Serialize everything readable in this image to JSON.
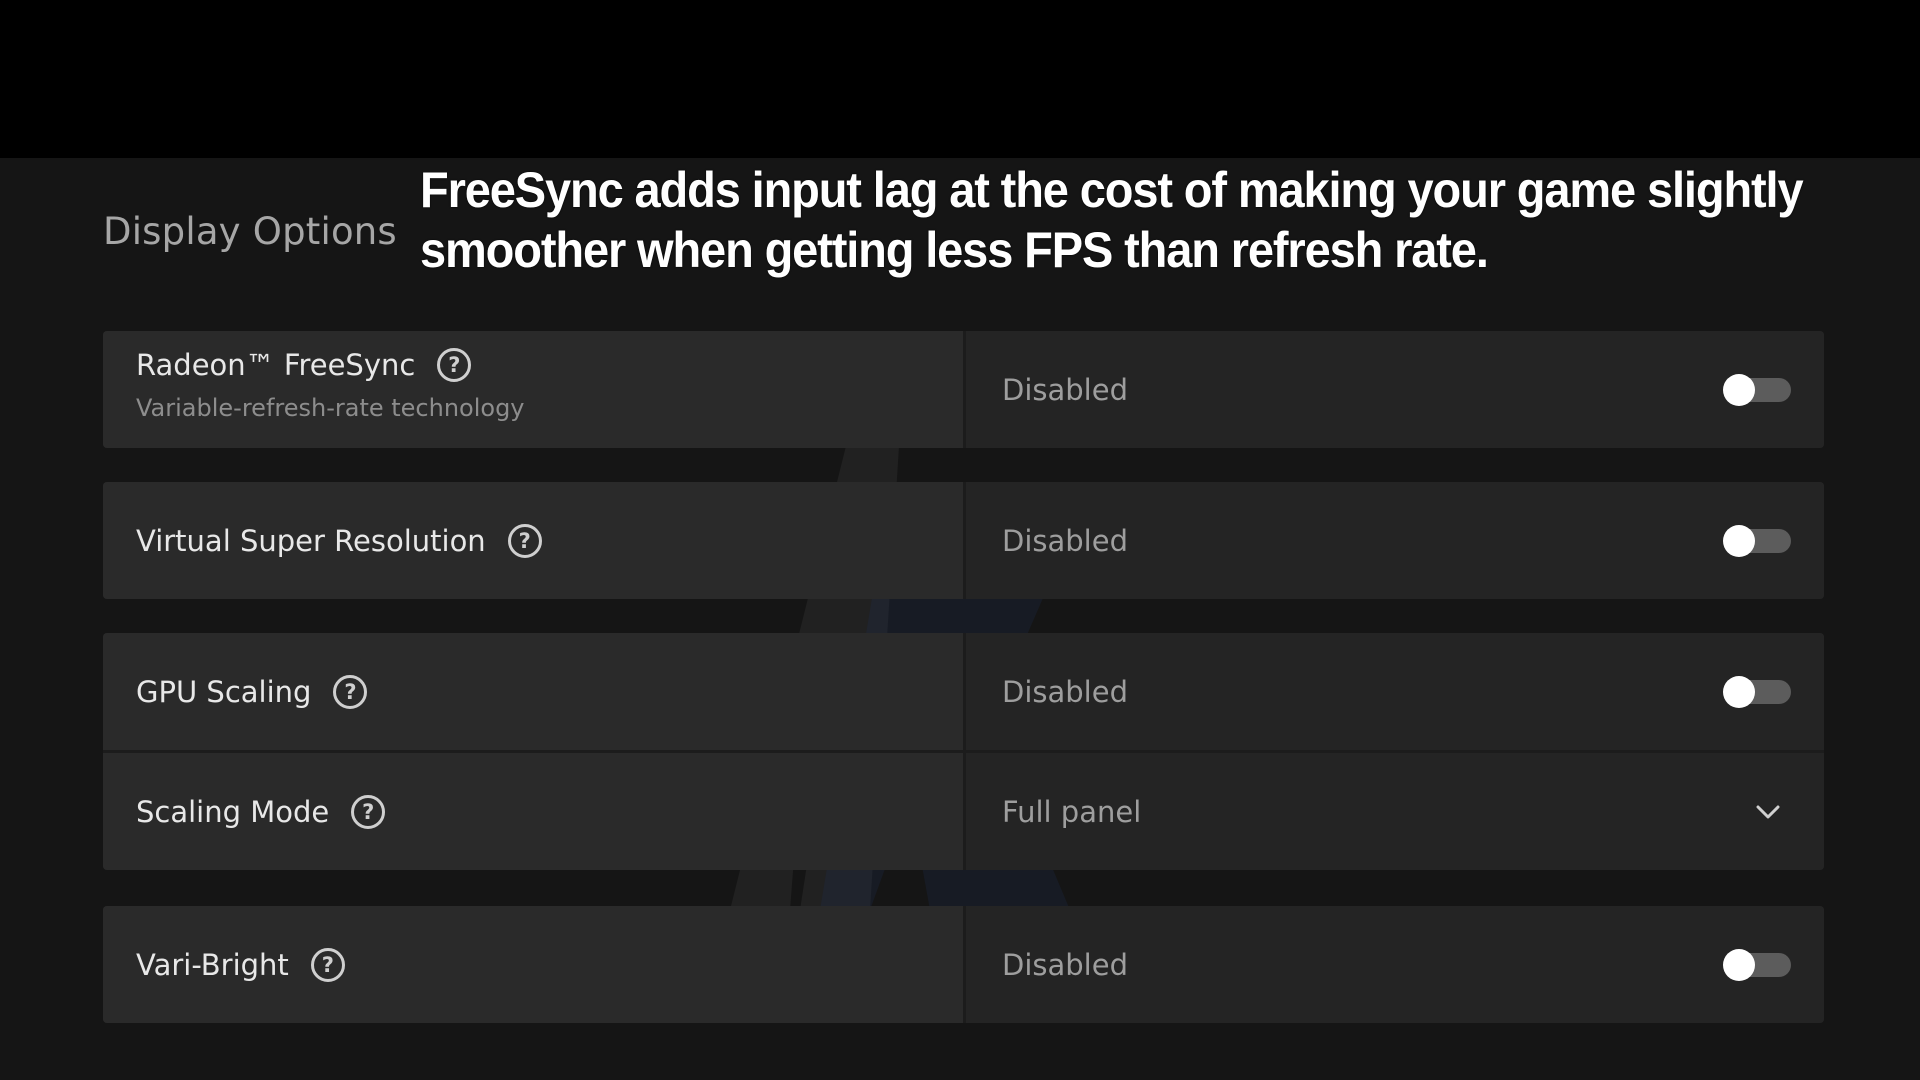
{
  "caption": "FreeSync adds input lag at the cost of making your game slightly smoother when getting less FPS than refresh rate.",
  "section_title": "Display Options",
  "settings": [
    {
      "label": "Radeon™ FreeSync",
      "sublabel": "Variable-refresh-rate technology",
      "value": "Disabled",
      "control": "toggle",
      "enabled": false
    },
    {
      "label": "Virtual Super Resolution",
      "value": "Disabled",
      "control": "toggle",
      "enabled": false
    },
    {
      "label": "GPU Scaling",
      "value": "Disabled",
      "control": "toggle",
      "enabled": false
    },
    {
      "label": "Scaling Mode",
      "value": "Full panel",
      "control": "dropdown"
    },
    {
      "label": "Vari-Bright",
      "value": "Disabled",
      "control": "toggle",
      "enabled": false
    }
  ],
  "help_glyph": "?",
  "icons": {
    "help": "question-circle-icon",
    "dropdown": "chevron-down-icon"
  },
  "colors": {
    "background": "#151515",
    "card_left": "#2a2a2a",
    "card_right": "#242424",
    "toggle_track": "#5c5c5c",
    "toggle_knob": "#ffffff"
  }
}
